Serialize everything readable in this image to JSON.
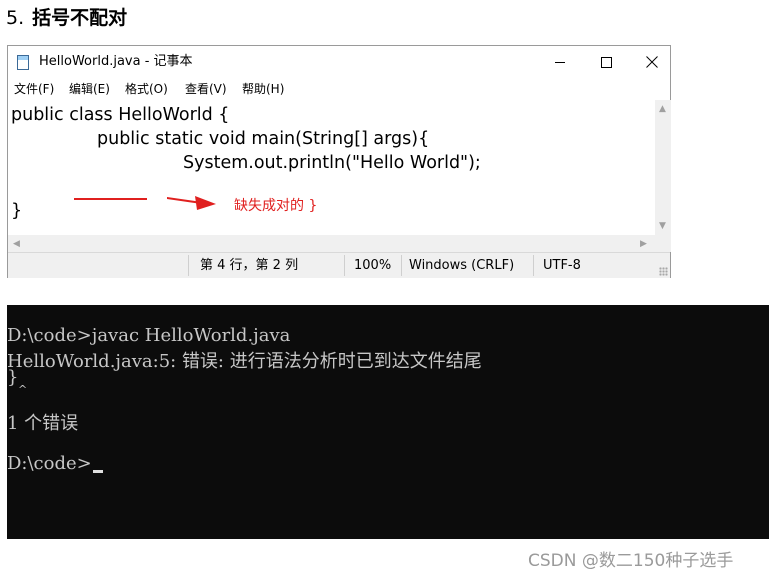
{
  "heading": {
    "number": "5.",
    "text": "括号不配对"
  },
  "notepad": {
    "title": "HelloWorld.java - 记事本",
    "menu": [
      "文件(F)",
      "编辑(E)",
      "格式(O)",
      "查看(V)",
      "帮助(H)"
    ],
    "code_lines": [
      "public class HelloWorld {",
      "public static void main(String[] args){",
      "System.out.println(\"Hello World\");",
      "",
      "}"
    ],
    "annotation": "缺失成对的 }",
    "annotation_color": "#e0201f",
    "status": {
      "position": "第 4 行，第 2 列",
      "zoom": "100%",
      "line_ending": "Windows (CRLF)",
      "encoding": "UTF-8"
    }
  },
  "console": {
    "lines": [
      "D:\\code>javac HelloWorld.java",
      "HelloWorld.java:5: 错误: 进行语法分析时已到达文件结尾",
      "}",
      "^",
      "1 个错误",
      "D:\\code>"
    ],
    "background": "#0c0c0c"
  },
  "watermark": "CSDN @数二150种子选手"
}
